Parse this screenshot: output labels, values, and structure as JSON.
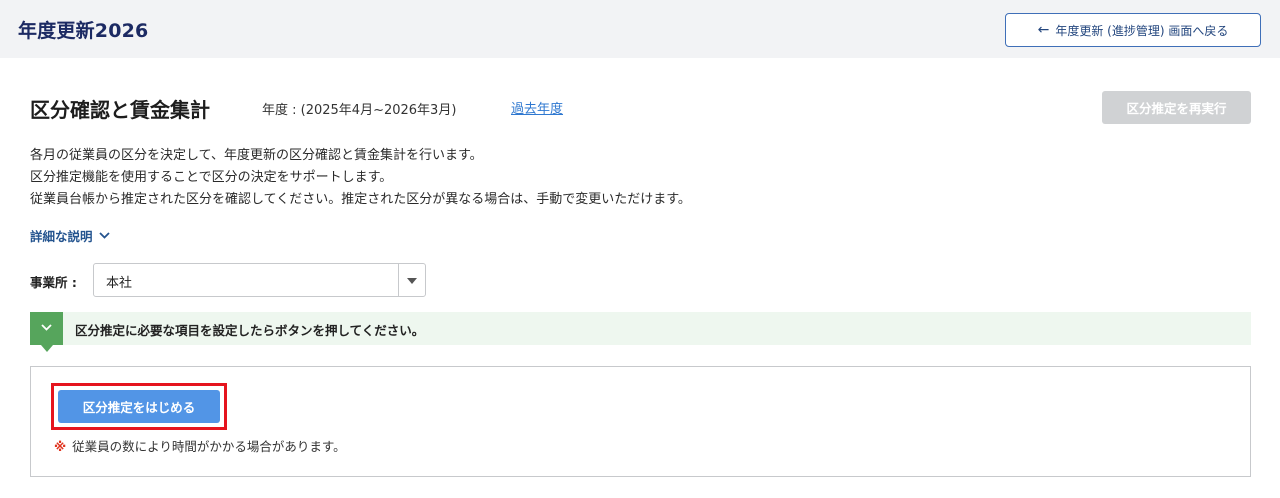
{
  "header": {
    "title": "年度更新2026",
    "back_button_label": "年度更新 (進捗管理) 画面へ戻る"
  },
  "main": {
    "title": "区分確認と賃金集計",
    "fiscal_year": "年度 : (2025年4月~2026年3月)",
    "past_year_link": "過去年度",
    "rerun_button_label": "区分推定を再実行",
    "description": [
      "各月の従業員の区分を決定して、年度更新の区分確認と賃金集計を行います。",
      "区分推定機能を使用することで区分の決定をサポートします。",
      "従業員台帳から推定された区分を確認してください。推定された区分が異なる場合は、手動で変更いただけます。"
    ],
    "detail_link": "詳細な説明"
  },
  "office": {
    "label": "事業所 :",
    "selected": "本社"
  },
  "notice": {
    "text": "区分推定に必要な項目を設定したらボタンを押してください。"
  },
  "panel": {
    "start_button_label": "区分推定をはじめる",
    "note_mark": "※",
    "note_text": "従業員の数により時間がかかる場合があります。"
  },
  "colors": {
    "header_bg": "#f2f3f5",
    "title_navy": "#1c2a63",
    "primary_button": "#5295e6",
    "disabled_button": "#d0d2d4",
    "notice_green": "#56a55c",
    "notice_bg": "#eef7ef",
    "highlight_red": "#e5141e",
    "link_blue": "#2f78d0"
  }
}
